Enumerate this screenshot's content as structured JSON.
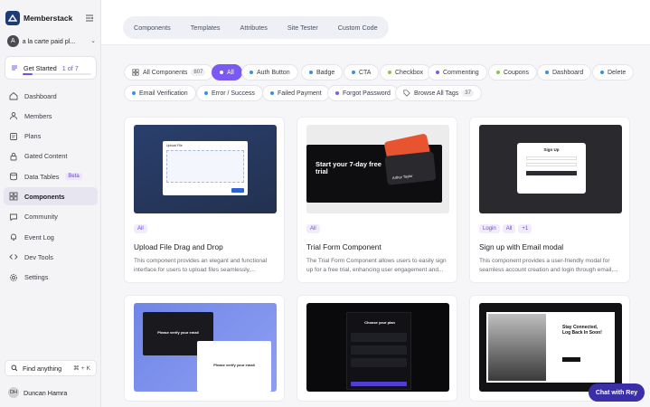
{
  "app": {
    "brand": "Memberstack",
    "workspace_initial": "A",
    "workspace_name": "a la carte paid pl..."
  },
  "get_started": {
    "label": "Get Started",
    "count": "1 of 7",
    "progress": 0.14
  },
  "nav": [
    {
      "label": "Dashboard",
      "icon": "home-icon"
    },
    {
      "label": "Members",
      "icon": "users-icon"
    },
    {
      "label": "Plans",
      "icon": "plans-icon"
    },
    {
      "label": "Gated Content",
      "icon": "lock-icon"
    },
    {
      "label": "Data Tables",
      "icon": "database-icon",
      "badge": "Beta"
    },
    {
      "label": "Components",
      "icon": "grid-icon",
      "active": true
    },
    {
      "label": "Community",
      "icon": "chat-icon"
    },
    {
      "label": "Event Log",
      "icon": "bell-icon"
    },
    {
      "label": "Dev Tools",
      "icon": "code-icon"
    },
    {
      "label": "Settings",
      "icon": "gear-icon"
    }
  ],
  "find": {
    "label": "Find anything",
    "shortcut": "⌘ + K"
  },
  "user": {
    "initials": "DH",
    "name": "Duncan Hamra"
  },
  "tabs": [
    "Components",
    "Templates",
    "Attributes",
    "Site Tester",
    "Custom Code"
  ],
  "filters_row1": [
    {
      "label": "All Components",
      "count": "807",
      "icon": "grid-icon"
    },
    {
      "label": "All",
      "active": true,
      "color": "#ffffff"
    },
    {
      "label": "Auth Button",
      "color": "#3a8ee6"
    },
    {
      "label": "Badge",
      "color": "#3a8ee6"
    },
    {
      "label": "CTA",
      "color": "#3a8ee6"
    },
    {
      "label": "Checkbox",
      "color": "#8bc34a"
    },
    {
      "label": "Commenting",
      "color": "#7a5af0"
    },
    {
      "label": "Coupons",
      "color": "#8bc34a"
    },
    {
      "label": "Dashboard",
      "color": "#3a8ee6"
    },
    {
      "label": "Delete",
      "color": "#3a8ee6"
    }
  ],
  "filters_row2": [
    {
      "label": "Email Verification",
      "color": "#3a8ee6"
    },
    {
      "label": "Error / Success",
      "color": "#3a8ee6"
    },
    {
      "label": "Failed Payment",
      "color": "#3a8ee6"
    },
    {
      "label": "Forgot Password",
      "color": "#7a5af0"
    },
    {
      "label": "Browse All Tags",
      "count": "37",
      "icon": "tag-icon"
    }
  ],
  "cards": [
    {
      "tags": [
        "All"
      ],
      "title": "Upload File Drag and Drop",
      "desc": "This component provides an elegant and functional interface for users to upload files seamlessly,..."
    },
    {
      "tags": [
        "All"
      ],
      "title": "Trial Form Component",
      "desc": "The Trial Form Component allows users to easily sign up for a free trial, enhancing user engagement and..."
    },
    {
      "tags": [
        "Login",
        "All",
        "+1"
      ],
      "title": "Sign up with Email modal",
      "desc": "This component provides a user-friendly modal for seamless account creation and login through email,..."
    }
  ],
  "thumbs": {
    "upload_title": "Upload File",
    "trial_headline_1": "Start your 7-day free",
    "trial_headline_2": "trial",
    "trial_card_name": "Arthur Taylor",
    "signup_title": "Sign Up",
    "verify_title": "Please verify your email",
    "plan_title": "Choose your plan",
    "stay_title_1": "Stay Connected,",
    "stay_title_2": "Log Back In Soon!"
  },
  "chat": {
    "label": "Chat with Rey"
  },
  "colors": {
    "accent": "#7a5af0",
    "chat": "#3b2fa8"
  }
}
